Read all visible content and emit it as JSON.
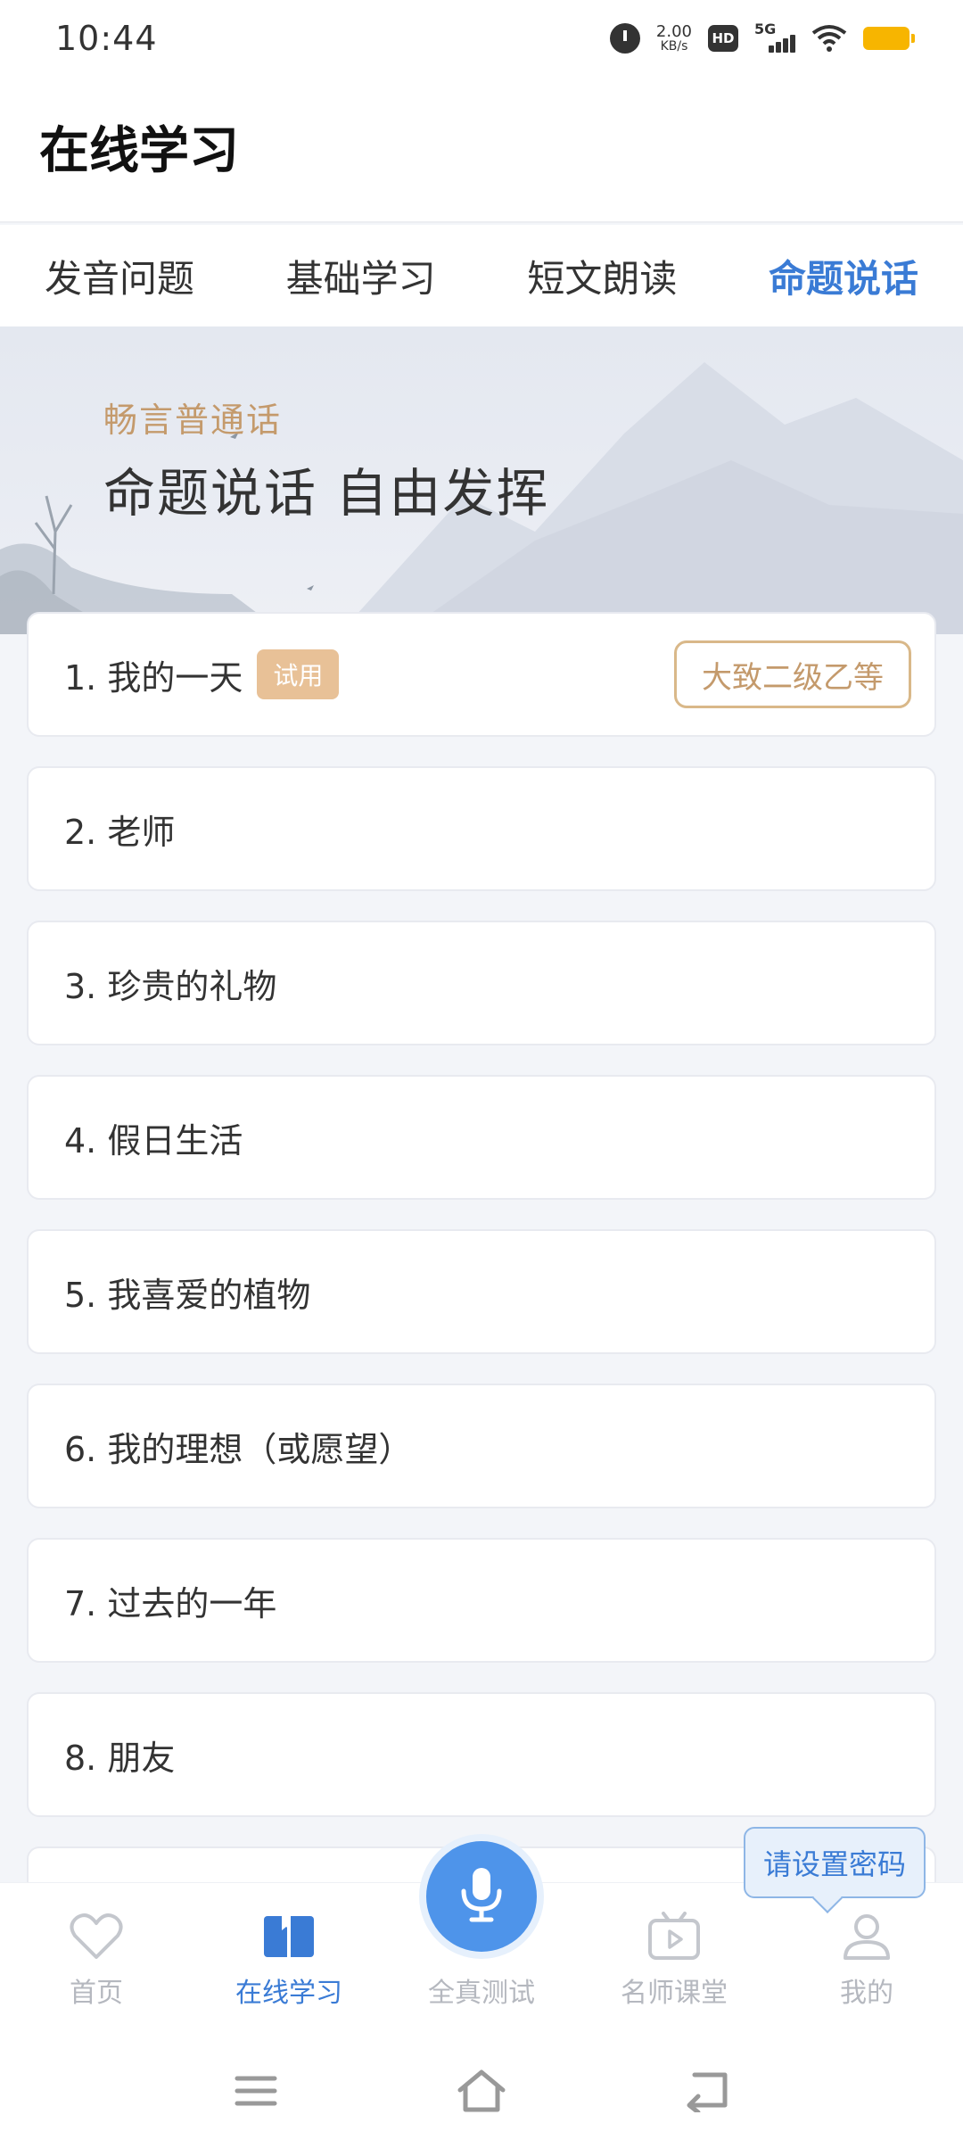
{
  "status_bar": {
    "time": "10:44",
    "speed_value": "2.00",
    "speed_unit": "KB/s",
    "hd_label": "HD",
    "network_label": "5G",
    "battery_color": "#f7b500"
  },
  "header": {
    "title": "在线学习"
  },
  "tabs": [
    {
      "label": "发音问题",
      "active": false
    },
    {
      "label": "基础学习",
      "active": false
    },
    {
      "label": "短文朗读",
      "active": false
    },
    {
      "label": "命题说话",
      "active": true
    }
  ],
  "banner": {
    "subtitle": "畅言普通话",
    "title": "命题说话 自由发挥"
  },
  "topics": [
    {
      "text": "1. 我的一天",
      "badge": "试用",
      "grade": "大致二级乙等"
    },
    {
      "text": "2. 老师"
    },
    {
      "text": "3. 珍贵的礼物"
    },
    {
      "text": "4. 假日生活"
    },
    {
      "text": "5. 我喜爱的植物"
    },
    {
      "text": "6. 我的理想（或愿望）"
    },
    {
      "text": "7. 过去的一年"
    },
    {
      "text": "8. 朋友"
    }
  ],
  "tooltip": "请设置密码",
  "bottom_nav": [
    {
      "label": "首页",
      "icon": "heart-icon",
      "active": false
    },
    {
      "label": "在线学习",
      "icon": "book-icon",
      "active": true
    },
    {
      "label": "全真测试",
      "icon": "microphone-icon",
      "active": false
    },
    {
      "label": "名师课堂",
      "icon": "tv-play-icon",
      "active": false
    },
    {
      "label": "我的",
      "icon": "user-icon",
      "active": false
    }
  ],
  "colors": {
    "accent": "#3a7bd5",
    "gold": "#c49a6c",
    "badge_bg": "#e8c197"
  }
}
